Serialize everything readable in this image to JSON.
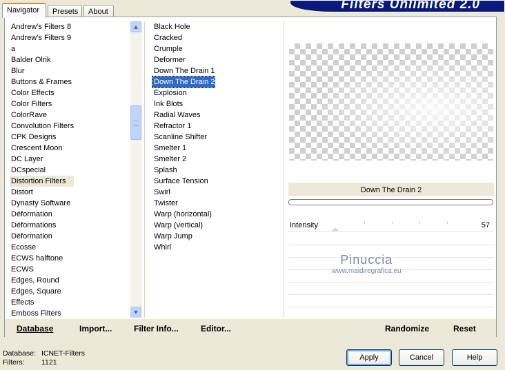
{
  "tabs": [
    "Navigator",
    "Presets",
    "About"
  ],
  "banner": "Filters Unlimited 2.0",
  "categories": [
    "Andrew's Filters 8",
    "Andrew's Filters 9",
    "a",
    "Balder Olrik",
    "Blur",
    "Buttons & Frames",
    "Color Effects",
    "Color Filters",
    "ColorRave",
    "Convolution Filters",
    "CPK Designs",
    "Crescent Moon",
    "DC Layer",
    "DCspecial",
    "Distortion Filters",
    "Distort",
    "Dynasty Software",
    "Déformation",
    "Déformations",
    "Déformation",
    "Ecosse",
    "ECWS halftone",
    "ECWS",
    "Edges, Round",
    "Edges, Square",
    "Effects",
    "Emboss Filters"
  ],
  "selected_category": "Distortion Filters",
  "filters": [
    "Black Hole",
    "Cracked",
    "Crumple",
    "Deformer",
    "Down The Drain 1",
    "Down The Drain 2",
    "Explosion",
    "Ink Blots",
    "Radial Waves",
    "Refractor 1",
    "Scanline Shifter",
    "Smelter 1",
    "Smelter 2",
    "Splash",
    "Surface Tension",
    "Swirl",
    "Twister",
    "Warp (horizontal)",
    "Warp (vertical)",
    "Warp Jump",
    "Whirl"
  ],
  "selected_filter": "Down The Drain 2",
  "preview": {
    "filter_name": "Down The Drain 2"
  },
  "params": [
    {
      "label": "Intensity",
      "value": "57"
    }
  ],
  "watermark": {
    "line1": "Pinuccia",
    "line2": "www.maidiregrafica.eu"
  },
  "bottom_buttons": {
    "database": "Database",
    "import": "Import...",
    "filter_info": "Filter Info...",
    "editor": "Editor...",
    "randomize": "Randomize",
    "reset": "Reset"
  },
  "status": {
    "database_label": "Database:",
    "database_value": "ICNET-Filters",
    "filters_label": "Filters:",
    "filters_value": "1121"
  },
  "dialog_buttons": {
    "apply": "Apply",
    "cancel": "Cancel",
    "help": "Help"
  },
  "colors": {
    "banner": "#0a1a7a",
    "selection": "#316ac5",
    "tab_highlight": "#e68b2c"
  }
}
